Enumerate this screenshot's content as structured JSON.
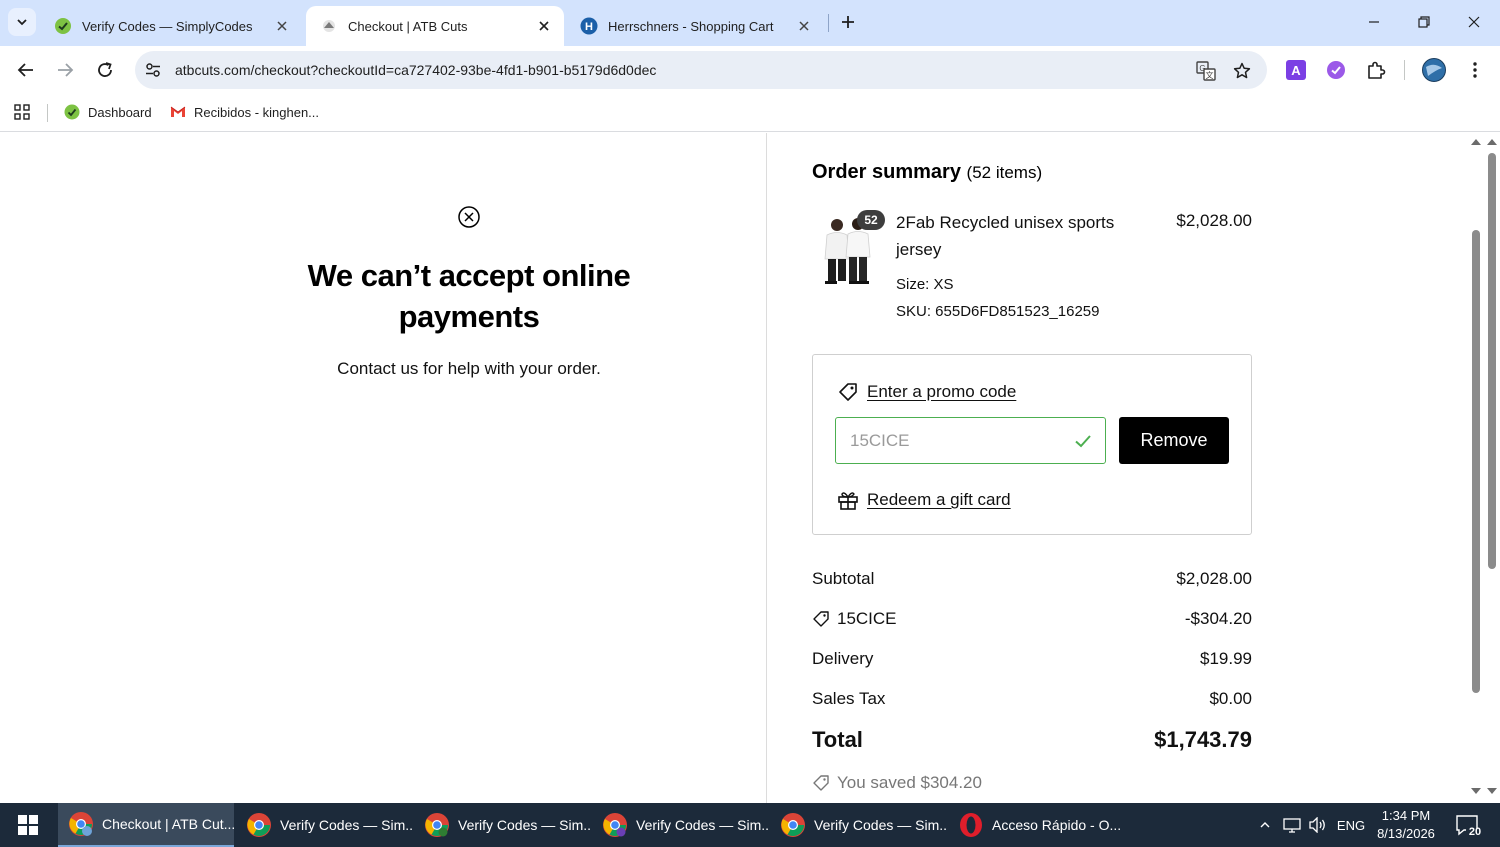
{
  "browser": {
    "tabs": [
      {
        "title": "Verify Codes — SimplyCodes",
        "favicon": "simplycodes-icon",
        "active": false
      },
      {
        "title": "Checkout | ATB Cuts",
        "favicon": "atbcuts-icon",
        "active": true
      },
      {
        "title": "Herrschners - Shopping Cart",
        "favicon": "herrschners-icon",
        "active": false
      }
    ],
    "url": "atbcuts.com/checkout?checkoutId=ca727402-93be-4fd1-b901-b5179d6d0dec",
    "bookmarks": [
      {
        "label": "Dashboard",
        "icon": "simplycodes-icon"
      },
      {
        "label": "Recibidos - kinghen...",
        "icon": "gmail-icon"
      }
    ]
  },
  "error_panel": {
    "title": "We can’t accept online payments",
    "subtitle": "Contact us for help with your order."
  },
  "summary": {
    "title": "Order summary",
    "count": "(52 items)",
    "product": {
      "name": "2Fab Recycled unisex sports jersey",
      "price": "$2,028.00",
      "quantity_badge": "52",
      "size": "Size: XS",
      "sku": "SKU: 655D6FD851523_16259"
    },
    "promo": {
      "link_label": "Enter a promo code",
      "code_value": "15CICE",
      "remove_label": "Remove",
      "gift_label": "Redeem a gift card"
    },
    "rows": [
      {
        "label": "Subtotal",
        "value": "$2,028.00"
      },
      {
        "label": "15CICE",
        "value": "-$304.20"
      },
      {
        "label": "Delivery",
        "value": "$19.99"
      },
      {
        "label": "Sales Tax",
        "value": "$0.00"
      }
    ],
    "total": {
      "label": "Total",
      "value": "$1,743.79"
    },
    "saved": "You saved $304.20"
  },
  "taskbar": {
    "items": [
      {
        "label": "Checkout | ATB Cut...",
        "active": true
      },
      {
        "label": "Verify Codes — Sim...",
        "active": false
      },
      {
        "label": "Verify Codes — Sim...",
        "active": false
      },
      {
        "label": "Verify Codes — Sim...",
        "active": false
      },
      {
        "label": "Verify Codes — Sim...",
        "active": false
      },
      {
        "label": "Acceso Rápido - O...",
        "active": false
      }
    ],
    "language": "ENG",
    "time": "1:34 PM",
    "date": "8/13/2026",
    "notifications": "20"
  },
  "colors": {
    "tabstrip": "#d3e3fd",
    "promo_valid": "#4caf50",
    "button": "#000000",
    "taskbar": "#1c2a3a"
  }
}
